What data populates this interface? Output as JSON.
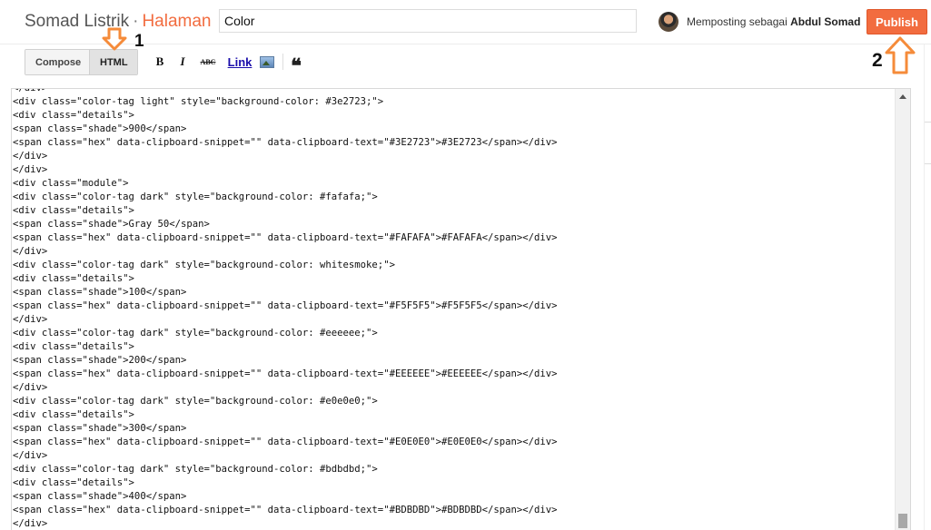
{
  "header": {
    "blog_name": "Somad Listrik",
    "separator": "·",
    "page_kind": "Halaman",
    "title_value": "Color",
    "posting_as_prefix": "Memposting sebagai",
    "user_name": "Abdul Somad",
    "publish_label": "Publish"
  },
  "toolbar": {
    "compose_label": "Compose",
    "html_label": "HTML",
    "bold_label": "B",
    "italic_label": "I",
    "strike_label": "ABC",
    "link_label": "Link",
    "image_icon": "image-icon",
    "quote_label": "❝"
  },
  "annotations": {
    "step1": "1",
    "step2": "2",
    "color": "#f58b3a"
  },
  "editor": {
    "lines": [
      "</div>",
      "<div class=\"color-tag light\" style=\"background-color: #3e2723;\">",
      "<div class=\"details\">",
      "<span class=\"shade\">900</span>",
      "<span class=\"hex\" data-clipboard-snippet=\"\" data-clipboard-text=\"#3E2723\">#3E2723</span></div>",
      "</div>",
      "</div>",
      "<div class=\"module\">",
      "<div class=\"color-tag dark\" style=\"background-color: #fafafa;\">",
      "<div class=\"details\">",
      "<span class=\"shade\">Gray 50</span>",
      "<span class=\"hex\" data-clipboard-snippet=\"\" data-clipboard-text=\"#FAFAFA\">#FAFAFA</span></div>",
      "</div>",
      "<div class=\"color-tag dark\" style=\"background-color: whitesmoke;\">",
      "<div class=\"details\">",
      "<span class=\"shade\">100</span>",
      "<span class=\"hex\" data-clipboard-snippet=\"\" data-clipboard-text=\"#F5F5F5\">#F5F5F5</span></div>",
      "</div>",
      "<div class=\"color-tag dark\" style=\"background-color: #eeeeee;\">",
      "<div class=\"details\">",
      "<span class=\"shade\">200</span>",
      "<span class=\"hex\" data-clipboard-snippet=\"\" data-clipboard-text=\"#EEEEEE\">#EEEEEE</span></div>",
      "</div>",
      "<div class=\"color-tag dark\" style=\"background-color: #e0e0e0;\">",
      "<div class=\"details\">",
      "<span class=\"shade\">300</span>",
      "<span class=\"hex\" data-clipboard-snippet=\"\" data-clipboard-text=\"#E0E0E0\">#E0E0E0</span></div>",
      "</div>",
      "<div class=\"color-tag dark\" style=\"background-color: #bdbdbd;\">",
      "<div class=\"details\">",
      "<span class=\"shade\">400</span>",
      "<span class=\"hex\" data-clipboard-snippet=\"\" data-clipboard-text=\"#BDBDBD\">#BDBDBD</span></div>",
      "</div>"
    ]
  }
}
